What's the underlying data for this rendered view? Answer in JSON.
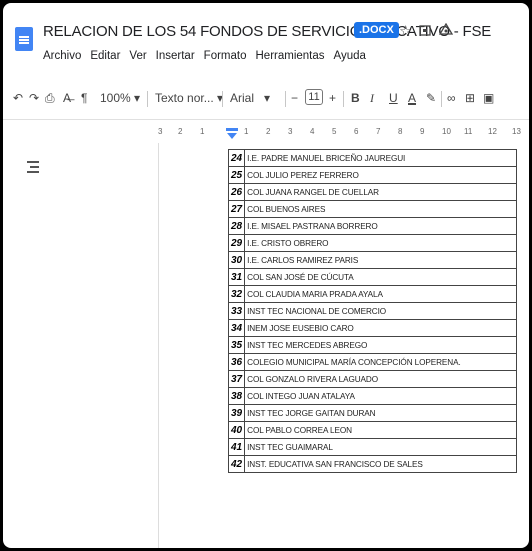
{
  "header": {
    "title": "RELACION DE LOS 54 FONDOS DE SERVICIO EDUCATIVO - FSE",
    "badge": ".DOCX",
    "icons": [
      "star-icon",
      "move-to-folder-icon",
      "cloud-status-icon"
    ]
  },
  "menu": [
    "Archivo",
    "Editar",
    "Ver",
    "Insertar",
    "Formato",
    "Herramientas",
    "Ayuda"
  ],
  "toolbar": {
    "zoom": "100%",
    "style": "Texto nor...",
    "font": "Arial",
    "font_size": "11",
    "bold": "B",
    "italic": "I",
    "underline": "U",
    "text_color": "A"
  },
  "ruler": {
    "numbers": [
      "3",
      "2",
      "1",
      "1",
      "2",
      "3",
      "4",
      "5",
      "6",
      "7",
      "8",
      "9",
      "10",
      "11",
      "12",
      "13"
    ]
  },
  "table": {
    "rows": [
      {
        "n": "24",
        "name": "I.E. PADRE MANUEL BRICEÑO JAUREGUI"
      },
      {
        "n": "25",
        "name": "COL JULIO PEREZ FERRERO"
      },
      {
        "n": "26",
        "name": "COL JUANA RANGEL DE CUELLAR"
      },
      {
        "n": "27",
        "name": "COL BUENOS AIRES"
      },
      {
        "n": "28",
        "name": "I.E. MISAEL PASTRANA BORRERO"
      },
      {
        "n": "29",
        "name": "I.E. CRISTO OBRERO"
      },
      {
        "n": "30",
        "name": "I.E. CARLOS RAMIREZ PARIS"
      },
      {
        "n": "31",
        "name": "COL SAN JOSÉ DE CÚCUTA"
      },
      {
        "n": "32",
        "name": "COL CLAUDIA MARIA PRADA AYALA"
      },
      {
        "n": "33",
        "name": "INST TEC NACIONAL DE COMERCIO"
      },
      {
        "n": "34",
        "name": "INEM JOSE EUSEBIO CARO"
      },
      {
        "n": "35",
        "name": "INST TEC MERCEDES ABREGO"
      },
      {
        "n": "36",
        "name": "COLEGIO MUNICIPAL MARÍA CONCEPCIÓN LOPERENA."
      },
      {
        "n": "37",
        "name": "COL GONZALO RIVERA LAGUADO"
      },
      {
        "n": "38",
        "name": "COL INTEGO JUAN ATALAYA"
      },
      {
        "n": "39",
        "name": "INST TEC JORGE GAITAN DURAN"
      },
      {
        "n": "40",
        "name": "COL PABLO CORREA LEON"
      },
      {
        "n": "41",
        "name": "INST TEC GUAIMARAL"
      },
      {
        "n": "42",
        "name": "INST. EDUCATIVA SAN FRANCISCO DE SALES"
      }
    ]
  }
}
